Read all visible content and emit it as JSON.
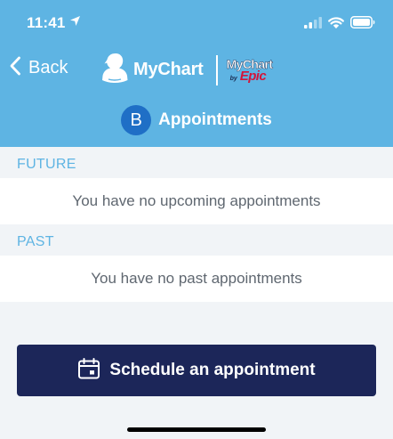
{
  "status_bar": {
    "time": "11:41",
    "icons": [
      "location-arrow-icon",
      "cellular-signal-icon",
      "wifi-icon",
      "battery-icon"
    ]
  },
  "nav": {
    "back_label": "Back",
    "brand_name": "MyChart",
    "epic_mychart": "MyChart",
    "epic_by": "by",
    "epic_name": "Epic"
  },
  "title": {
    "avatar_initial": "B",
    "text": "Appointments"
  },
  "sections": {
    "future": {
      "label": "FUTURE",
      "empty_text": "You have no upcoming appointments"
    },
    "past": {
      "label": "PAST",
      "empty_text": "You have no past appointments"
    }
  },
  "schedule_button": {
    "label": "Schedule an appointment",
    "icon": "calendar-icon"
  },
  "colors": {
    "header": "#5eb4e3",
    "avatar": "#1f6fc6",
    "button": "#1c2659",
    "section_label": "#5eb4e3",
    "epic_red": "#d3153a"
  }
}
